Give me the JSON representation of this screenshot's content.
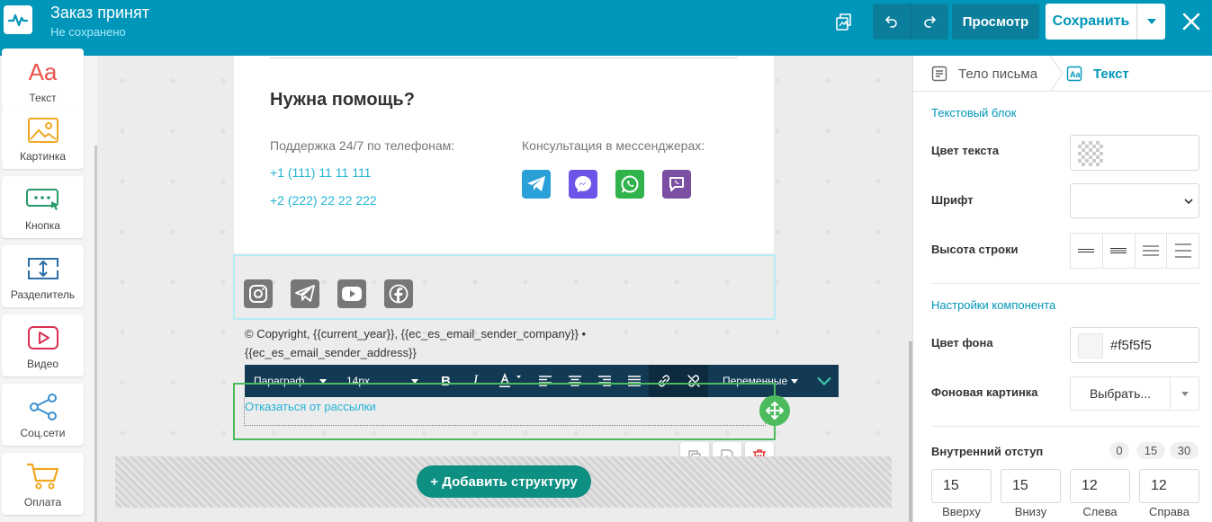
{
  "header": {
    "title": "Заказ принят",
    "subtitle": "Не сохранено",
    "preview_label": "Просмотр",
    "save_label": "Сохранить"
  },
  "sidebar": {
    "items": [
      {
        "label": "Текст",
        "icon": "text-aa-icon"
      },
      {
        "label": "Картинка",
        "icon": "image-icon"
      },
      {
        "label": "Кнопка",
        "icon": "button-icon"
      },
      {
        "label": "Разделитель",
        "icon": "divider-icon"
      },
      {
        "label": "Видео",
        "icon": "video-icon"
      },
      {
        "label": "Соц.сети",
        "icon": "share-icon"
      },
      {
        "label": "Оплата",
        "icon": "cart-icon"
      }
    ]
  },
  "canvas": {
    "help_title": "Нужна помощь?",
    "support_label": "Поддержка 24/7 по телефонам:",
    "phones": [
      "+1 (111) 11 11 111",
      "+2 (222) 22 22 222"
    ],
    "messengers_label": "Консультация в мессенджерах:",
    "copyright": "© Copyright, {{current_year}}, {{ec_es_email_sender_company}} • {{ec_es_email_sender_address}}",
    "unsubscribe": "Отказаться от рассылки",
    "add_structure": "+ Добавить структуру",
    "toolbar": {
      "paragraph": "Параграф",
      "font_size": "14px",
      "variables": "Переменные"
    }
  },
  "panel": {
    "crumb_body": "Тело письма",
    "crumb_text": "Текст",
    "section_text_block": "Текстовый блок",
    "text_color_label": "Цвет текста",
    "font_label": "Шрифт",
    "line_height_label": "Высота строки",
    "section_component": "Настройки компонента",
    "bg_color_label": "Цвет фона",
    "bg_color_value": "#f5f5f5",
    "bg_image_label": "Фоновая картинка",
    "choose_label": "Выбрать...",
    "padding_label": "Внутренний отступ",
    "padding_presets": [
      "0",
      "15",
      "30"
    ],
    "padding": [
      {
        "label": "Вверху",
        "value": "15"
      },
      {
        "label": "Внизу",
        "value": "15"
      },
      {
        "label": "Слева",
        "value": "12"
      },
      {
        "label": "Справа",
        "value": "12"
      }
    ]
  },
  "colors": {
    "topbar": "#0096b9",
    "accent": "#22b4d6",
    "selection_green": "#4cbb5e",
    "toolbar_dark": "#133a54"
  }
}
